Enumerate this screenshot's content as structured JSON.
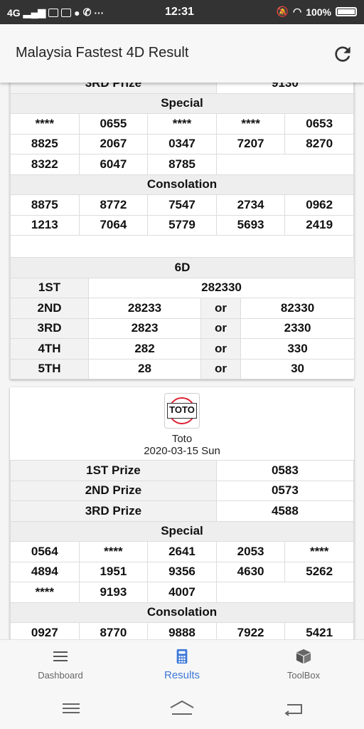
{
  "status_bar": {
    "network": "4G",
    "time": "12:31",
    "battery": "100%"
  },
  "app_bar": {
    "title": "Malaysia Fastest 4D Result",
    "refresh_icon": "refresh-icon"
  },
  "card1": {
    "partial_prize_label": "3RD Prize",
    "partial_prize_value": "9130",
    "special_header": "Special",
    "special_rows": [
      [
        "****",
        "0655",
        "****",
        "****",
        "0653"
      ],
      [
        "8825",
        "2067",
        "0347",
        "7207",
        "8270"
      ],
      [
        "8322",
        "6047",
        "8785"
      ]
    ],
    "consolation_header": "Consolation",
    "consolation_rows": [
      [
        "8875",
        "8772",
        "7547",
        "2734",
        "0962"
      ],
      [
        "1213",
        "7064",
        "5779",
        "5693",
        "2419"
      ]
    ],
    "sixd": {
      "header": "6D",
      "rows": [
        {
          "label": "1ST",
          "value": "282330"
        },
        {
          "label": "2ND",
          "a": "28233",
          "or": "or",
          "b": "82330"
        },
        {
          "label": "3RD",
          "a": "2823",
          "or": "or",
          "b": "2330"
        },
        {
          "label": "4TH",
          "a": "282",
          "or": "or",
          "b": "330"
        },
        {
          "label": "5TH",
          "a": "28",
          "or": "or",
          "b": "30"
        }
      ]
    }
  },
  "card2": {
    "logo_text": "TOTO",
    "name": "Toto",
    "date": "2020-03-15 Sun",
    "prizes": [
      {
        "label": "1ST Prize",
        "value": "0583"
      },
      {
        "label": "2ND Prize",
        "value": "0573"
      },
      {
        "label": "3RD Prize",
        "value": "4588"
      }
    ],
    "special_header": "Special",
    "special_rows": [
      [
        "0564",
        "****",
        "2641",
        "2053",
        "****"
      ],
      [
        "4894",
        "1951",
        "9356",
        "4630",
        "5262"
      ],
      [
        "****",
        "9193",
        "4007"
      ]
    ],
    "consolation_header": "Consolation",
    "consolation_rows": [
      [
        "0927",
        "8770",
        "9888",
        "7922",
        "5421"
      ]
    ]
  },
  "bottom_nav": {
    "items": [
      {
        "label": "Dashboard",
        "icon": "menu-icon"
      },
      {
        "label": "Results",
        "icon": "calculator-icon",
        "active": true
      },
      {
        "label": "ToolBox",
        "icon": "box-icon"
      }
    ]
  },
  "colors": {
    "accent": "#3d78d8",
    "statusbar": "#333333",
    "header_cell": "#eeeeee"
  }
}
